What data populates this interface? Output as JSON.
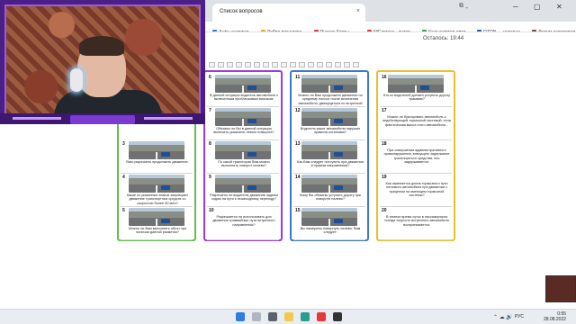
{
  "browser": {
    "tab_title": "Список вопросов",
    "tab_close": "×",
    "minimize": "─",
    "maximize": "▢",
    "close": "✕",
    "tab_tools": "⧉  ⌄",
    "bookmarks": [
      {
        "label": "Auto: недвижи...",
        "color": "#2c7be5"
      },
      {
        "label": "Добро пожалова...",
        "color": "#f3a712"
      },
      {
        "label": "Яндекс.Карты —...",
        "color": "#e53935"
      },
      {
        "label": "AliExpress - интер...",
        "color": "#e53935"
      },
      {
        "label": "Калькулятор ипот...",
        "color": "#43a047"
      },
      {
        "label": "OZON — интерне...",
        "color": "#1565c0"
      },
      {
        "label": "Форум оздоровил...",
        "color": "#6d4c41"
      },
      {
        "label": "МегаПДД",
        "color": "#1565c0"
      },
      {
        "label": "Ficheiro.org • весьн...",
        "color": "#8e24aa"
      }
    ]
  },
  "page": {
    "timer": "Осталось: 19:44",
    "nav_count": 17
  },
  "columns": [
    {
      "border": "#61c04b",
      "cards": [
        {
          "num": "3",
          "text": "Вам разрешено продолжить движение:",
          "img": true
        },
        {
          "num": "4",
          "text": "Какие из указанных знаков запрещают движение транспортных средств со скоростью более 50 км/ч?",
          "img": true
        },
        {
          "num": "5",
          "text": "Можно ли Вам выполнить обгон при наличии данной разметки?",
          "img": true
        }
      ]
    },
    {
      "border": "#9c3ae0",
      "cards": [
        {
          "num": "6",
          "text": "В данной ситуации водитель автомобиля с включенным проблесковым маячком:",
          "img": true
        },
        {
          "num": "7",
          "text": "Обязаны ли Вы в данной ситуации включить указатель левого поворота?",
          "img": true
        },
        {
          "num": "8",
          "text": "По какой траектории Вам можно выполнить поворот налево?",
          "img": true
        },
        {
          "num": "9",
          "text": "Разрешено ли водителю движение задним ходом на пути к пешеходному переходу?",
          "img": true
        },
        {
          "num": "10",
          "text": "Разрешается ли использовать для движения трамвайные пути встречного направления?",
          "img": false
        }
      ]
    },
    {
      "border": "#3f78c9",
      "cards": [
        {
          "num": "11",
          "text": "Можно ли Вам продолжить движение по среднему полосе после включения автомобиля, движущегося по встречной полосе?",
          "img": true
        },
        {
          "num": "12",
          "text": "Водитель какое автомобиля нарушил правила остановки?",
          "img": true
        },
        {
          "num": "13",
          "text": "Как Вам следует поступить при движении в прямом направлении?",
          "img": true
        },
        {
          "num": "14",
          "text": "Кому Вы обязаны уступить дорогу при повороте налево?",
          "img": true
        },
        {
          "num": "15",
          "text": "Вы намерены повернуть налево. Вам следует:",
          "img": true
        }
      ]
    },
    {
      "border": "#efbd2c",
      "cards": [
        {
          "num": "16",
          "text": "Кто из водителей должен уступить дорогу трамваю?",
          "img": true
        },
        {
          "num": "17",
          "text": "Можно ли буксировать автомобиль с недействующей тормозной системой, если фактическая масса этого автомобиля...",
          "img": false
        },
        {
          "num": "18",
          "text": "При совершении административного правонарушения, влекущего задержание транспортного средства, оно задерживается:",
          "img": false
        },
        {
          "num": "19",
          "text": "Как изменяется длина тормозного пути легкового автомобиля при движении с прицепом на имеющем тормозной системы?",
          "img": false
        },
        {
          "num": "20",
          "text": "В темное время суток в пассажирском поезде скорость встречного автомобиля воспринимается:",
          "img": false
        }
      ]
    }
  ],
  "taskbar": {
    "lang": "РУС",
    "time": "0:55",
    "date": "28.08.2022",
    "tray": "⌃ ☁ 🔊"
  }
}
